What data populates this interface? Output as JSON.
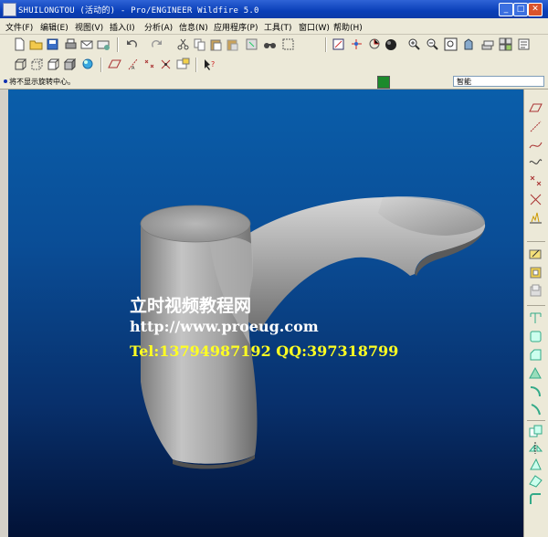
{
  "window": {
    "title": "SHUILONGTOU (活动的) - Pro/ENGINEER Wildfire 5.0",
    "minimize_label": "_",
    "maximize_label": "□",
    "close_label": "✕"
  },
  "menu": {
    "items": [
      "文件(F)",
      "编辑(E)",
      "视图(V)",
      "插入(I)",
      "分析(A)",
      "信息(N)",
      "应用程序(P)",
      "工具(T)",
      "窗口(W)",
      "帮助(H)"
    ]
  },
  "toolbar_row1": {
    "icons": [
      "new-file-icon",
      "open-folder-icon",
      "save-icon",
      "print-icon",
      "email-icon",
      "email-attach-icon",
      "undo-icon",
      "redo-icon",
      "cut-icon",
      "copy-icon",
      "paste-icon",
      "paste-special-icon",
      "regenerate-icon",
      "find-icon",
      "select-box-icon",
      "refit-icon",
      "spin-center-icon",
      "orient-icon",
      "shading-icon",
      "zoom-in-icon",
      "zoom-out-icon",
      "zoom-fit-icon",
      "saved-views-icon",
      "layers-icon",
      "view-manager-icon"
    ]
  },
  "toolbar_row2": {
    "icons": [
      "wireframe-icon",
      "hidden-line-icon",
      "no-hidden-icon",
      "shaded-icon",
      "shaded-edges-icon",
      "datum-planes-icon",
      "datum-axes-icon",
      "datum-points-icon",
      "coordinate-systems-icon",
      "context-help-icon"
    ]
  },
  "status": {
    "message": "将不显示旋转中心。",
    "filter_value": "智能"
  },
  "right_toolbar": {
    "icons": [
      "datum-plane-icon",
      "datum-axis-icon",
      "datum-curve-icon",
      "sketch-curve-icon",
      "datum-point-icon",
      "coord-sys-icon",
      "analysis-icon",
      "sketch-icon",
      "extrude-icon",
      "revolve-icon",
      "hole-icon",
      "round-icon",
      "chamfer-icon",
      "shell-icon",
      "rib-icon",
      "draft-icon",
      "copy-feature-icon",
      "mirror-icon",
      "merge-icon",
      "trim-icon",
      "sweep-icon"
    ]
  },
  "watermark": {
    "line1": "立时视频教程网",
    "line2": "http://www.proeug.com",
    "line3": "Tel:13794987192  QQ:397318799"
  },
  "colors": {
    "title_bar": "#0a3fb8",
    "viewport_top": "#0a5eaa",
    "viewport_bottom": "#021236",
    "model": "#a8a8a8",
    "watermark_yellow": "#ffff22"
  }
}
